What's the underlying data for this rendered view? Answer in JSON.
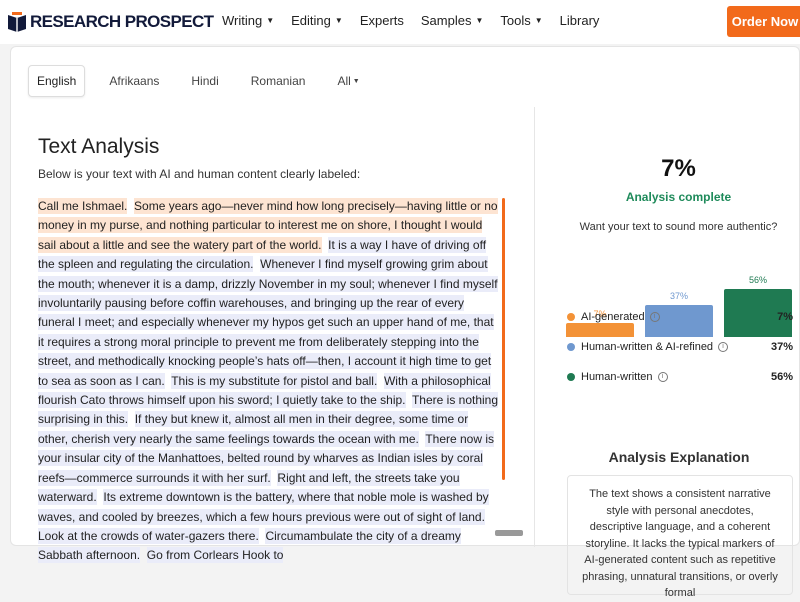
{
  "header": {
    "logo_text": "RESEARCH PROSPECT",
    "nav": [
      {
        "label": "Writing",
        "has_dropdown": true
      },
      {
        "label": "Editing",
        "has_dropdown": true
      },
      {
        "label": "Experts",
        "has_dropdown": false
      },
      {
        "label": "Samples",
        "has_dropdown": true
      },
      {
        "label": "Tools",
        "has_dropdown": true
      },
      {
        "label": "Library",
        "has_dropdown": false
      }
    ],
    "order_button": "Order Now",
    "accent_color": "#f26a1b"
  },
  "tabs": [
    {
      "label": "English",
      "active": true
    },
    {
      "label": "Afrikaans",
      "active": false
    },
    {
      "label": "Hindi",
      "active": false
    },
    {
      "label": "Romanian",
      "active": false
    },
    {
      "label": "All",
      "active": false,
      "has_dropdown": true
    }
  ],
  "analysis": {
    "title": "Text Analysis",
    "subtitle": "Below is your text with AI and human content clearly labeled:",
    "segments": [
      {
        "type": "ai",
        "text": "Call me Ishmael."
      },
      {
        "type": "ai",
        "text": "Some years ago—never mind how long precisely—having little or no money in my purse, and nothing particular to interest me on shore, I thought I would sail about a little and see the watery part of the world."
      },
      {
        "type": "human",
        "text": "It is a way I have of driving off the spleen and regulating the circulation."
      },
      {
        "type": "human",
        "text": "Whenever I find myself growing grim about the mouth; whenever it is a damp, drizzly November in my soul; whenever I find myself involuntarily pausing before coffin warehouses, and bringing up the rear of every funeral I meet; and especially whenever my hypos get such an upper hand of me, that it requires a strong moral principle to prevent me from deliberately stepping into the street, and methodically knocking people’s hats off—then, I account it high time to get to sea as soon as I can."
      },
      {
        "type": "human",
        "text": "This is my substitute for pistol and ball."
      },
      {
        "type": "human",
        "text": "With a philosophical flourish Cato throws himself upon his sword; I quietly take to the ship."
      },
      {
        "type": "human",
        "text": "There is nothing surprising in this."
      },
      {
        "type": "human",
        "text": "If they but knew it, almost all men in their degree, some time or other, cherish very nearly the same feelings towards the ocean with me."
      },
      {
        "type": "human",
        "text": "There now is your insular city of the Manhattoes, belted round by wharves as Indian isles by coral reefs—commerce surrounds it with her surf."
      },
      {
        "type": "human",
        "text": "Right and left, the streets take you waterward."
      },
      {
        "type": "human",
        "text": "Its extreme downtown is the battery, where that noble mole is washed by waves, and cooled by breezes, which a few hours previous were out of sight of land."
      },
      {
        "type": "human",
        "text": "Look at the crowds of water-gazers there."
      },
      {
        "type": "human",
        "text": "Circumambulate the city of a dreamy Sabbath afternoon."
      },
      {
        "type": "human",
        "text": "Go from Corlears Hook to"
      }
    ]
  },
  "results": {
    "percent": "7%",
    "status": "Analysis complete",
    "question": "Want your text to sound more authentic?",
    "bars": [
      {
        "label": "7%",
        "value": 7,
        "color": "#f39237"
      },
      {
        "label": "37%",
        "value": 37,
        "color": "#6f98cf"
      },
      {
        "label": "56%",
        "value": 56,
        "color": "#1f7a52"
      }
    ],
    "legend": [
      {
        "label": "AI-generated",
        "value": "7%",
        "color": "#f39237"
      },
      {
        "label": "Human-written & AI-refined",
        "value": "37%",
        "color": "#6f98cf"
      },
      {
        "label": "Human-written",
        "value": "56%",
        "color": "#1f7a52"
      }
    ],
    "status_color": "#1e8a5a",
    "explanation_title": "Analysis Explanation",
    "explanation_text": "The text shows a consistent narrative style with personal anecdotes, descriptive language, and a coherent storyline. It lacks the typical markers of AI-generated content such as repetitive phrasing, unnatural transitions, or overly formal"
  }
}
